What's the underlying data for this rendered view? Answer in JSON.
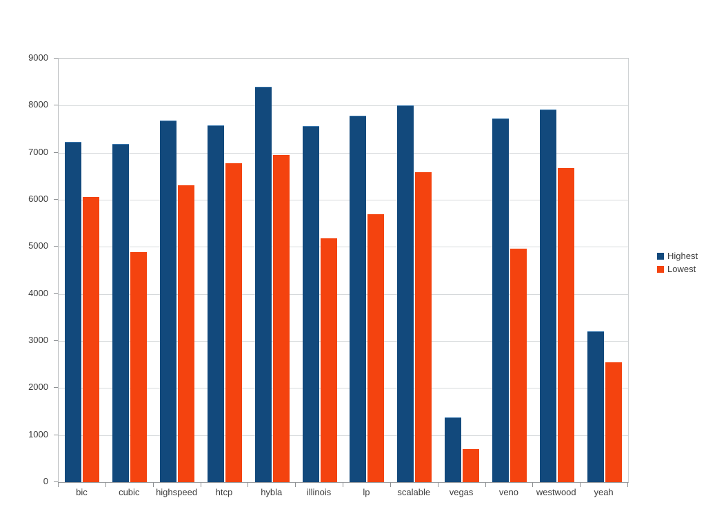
{
  "chart_data": {
    "type": "bar",
    "title": "",
    "xlabel": "",
    "ylabel": "",
    "ylim": [
      0,
      9000
    ],
    "ytick_step": 1000,
    "grid": true,
    "legend_position": "right",
    "categories": [
      "bic",
      "cubic",
      "highspeed",
      "htcp",
      "hybla",
      "illinois",
      "lp",
      "scalable",
      "vegas",
      "veno",
      "westwood",
      "yeah"
    ],
    "ytick_labels": [
      "9000",
      "8000",
      "7000",
      "6000",
      "5000",
      "4000",
      "3000",
      "2000",
      "1000",
      "0"
    ],
    "series": [
      {
        "name": "Highest",
        "color": "#12497c",
        "values": [
          7230,
          7180,
          7680,
          7580,
          8400,
          7570,
          7780,
          8010,
          1380,
          7730,
          7920,
          3200
        ]
      },
      {
        "name": "Lowest",
        "color": "#f4430f",
        "values": [
          6060,
          4890,
          6310,
          6780,
          6950,
          5180,
          5690,
          6590,
          700,
          4960,
          6680,
          2545
        ]
      }
    ]
  },
  "legend": {
    "entries": [
      {
        "label": "Highest",
        "color": "#12497c"
      },
      {
        "label": "Lowest",
        "color": "#f4430f"
      }
    ]
  },
  "colors": {
    "highest": "#12497c",
    "lowest": "#f4430f",
    "gridline": "#d6d9db",
    "axis": "#8d9093",
    "text": "#3b3b3b",
    "background": "#ffffff"
  }
}
